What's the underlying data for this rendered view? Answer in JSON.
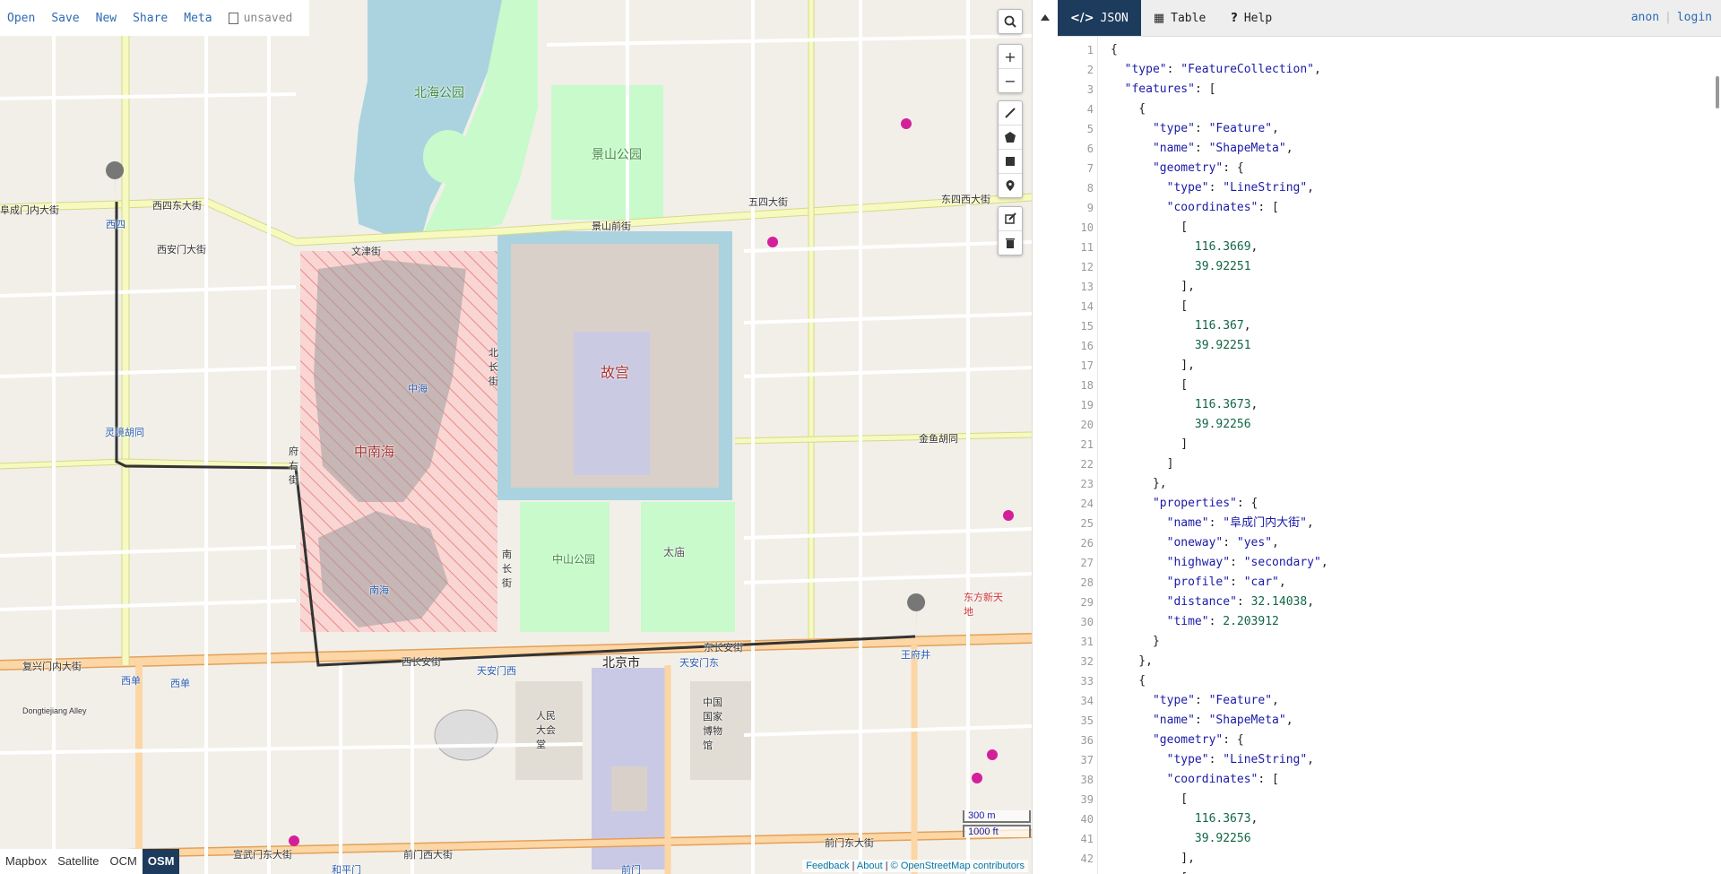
{
  "file_menu": {
    "items": [
      "Open",
      "Save",
      "New",
      "Share",
      "Meta"
    ],
    "status": "unsaved"
  },
  "map": {
    "labels": {
      "beihai_park": "北海公园",
      "jingshan_park": "景山公园",
      "forbidden_city": "故宫",
      "zhongnanhai": "中南海",
      "zhonghai": "中海",
      "nanhai": "南海",
      "zhongshan_park": "中山公园",
      "taimiao": "太庙",
      "beijing_city": "北京市",
      "tiananmen_west": "天安门西",
      "tiananmen_east": "天安门东",
      "xisi": "西四",
      "lingjing": "灵境胡同",
      "xidan": "西单",
      "xidan2": "西单",
      "wangfujing": "王府井",
      "renmin_dahuitang": "人民大会堂",
      "guojia_bowuguan": "中国国家博物馆",
      "dongfang_xintiandi": "东方新天地",
      "dongchang_an": "东长安街",
      "xichang_an": "西长安街",
      "fuchengmen": "阜成门内大街",
      "xisidong": "西四东大街",
      "xianmen": "西安门大街",
      "wenjin": "文津街",
      "jingshanqian": "景山前街",
      "wusi": "五四大街",
      "dongsixi": "东四西大街",
      "jinyu": "金鱼胡同",
      "qianmen_west": "前门西大街",
      "qianmen_east": "前门东大街",
      "qianmen": "前门",
      "hepingmen": "和平门",
      "fuxingmen": "复兴门内大街",
      "xuanwumen": "宣武门东大街",
      "dongtiejiang": "Dongtiejiang Alley",
      "nanchang": "南长街",
      "beichang": "北长街",
      "fuyou": "府右街"
    },
    "controls": {
      "search": "search-icon",
      "zoom_in": "+",
      "zoom_out": "−"
    },
    "layers": [
      "Mapbox",
      "Satellite",
      "OCM",
      "OSM"
    ],
    "active_layer": "OSM",
    "scale": [
      "300 m",
      "1000 ft"
    ],
    "attribution": {
      "feedback": "Feedback",
      "about": "About",
      "osm": "© OpenStreetMap contributors"
    },
    "colors": {
      "land": "#f2efe9",
      "park": "#c8facc",
      "water": "#aad3df",
      "forbidden": "#d9d0c9",
      "hatch": "#f4a8a8",
      "major_road": "#fcd6a4",
      "primary_road": "#f7fabf",
      "route": "#333333"
    }
  },
  "editor": {
    "tabs": [
      {
        "label": "JSON",
        "icon": "code-icon",
        "active": true
      },
      {
        "label": "Table",
        "icon": "table-icon",
        "active": false
      },
      {
        "label": "Help",
        "icon": "help-icon",
        "active": false
      }
    ],
    "user": {
      "anon": "anon",
      "login": "login"
    },
    "line_numbers": [
      "1",
      "2",
      "3",
      "4",
      "5",
      "6",
      "7",
      "8",
      "9",
      "10",
      "11",
      "12",
      "13",
      "14",
      "15",
      "16",
      "17",
      "18",
      "19",
      "20",
      "21",
      "22",
      "23",
      "24",
      "25",
      "26",
      "27",
      "28",
      "29",
      "30",
      "31",
      "32",
      "33",
      "34",
      "35",
      "36",
      "37",
      "38",
      "39",
      "40",
      "41",
      "42"
    ],
    "code_lines": [
      "{",
      "  \"type\": \"FeatureCollection\",",
      "  \"features\": [",
      "    {",
      "      \"type\": \"Feature\",",
      "      \"name\": \"ShapeMeta\",",
      "      \"geometry\": {",
      "        \"type\": \"LineString\",",
      "        \"coordinates\": [",
      "          [",
      "            116.3669,",
      "            39.92251",
      "          ],",
      "          [",
      "            116.367,",
      "            39.92251",
      "          ],",
      "          [",
      "            116.3673,",
      "            39.92256",
      "          ]",
      "        ]",
      "      },",
      "      \"properties\": {",
      "        \"name\": \"阜成门内大街\",",
      "        \"oneway\": \"yes\",",
      "        \"highway\": \"secondary\",",
      "        \"profile\": \"car\",",
      "        \"distance\": 32.14038,",
      "        \"time\": 2.203912",
      "      }",
      "    },",
      "    {",
      "      \"type\": \"Feature\",",
      "      \"name\": \"ShapeMeta\",",
      "      \"geometry\": {",
      "        \"type\": \"LineString\",",
      "        \"coordinates\": [",
      "          [",
      "            116.3673,",
      "            39.92256",
      "          ],",
      "          ["
    ]
  }
}
